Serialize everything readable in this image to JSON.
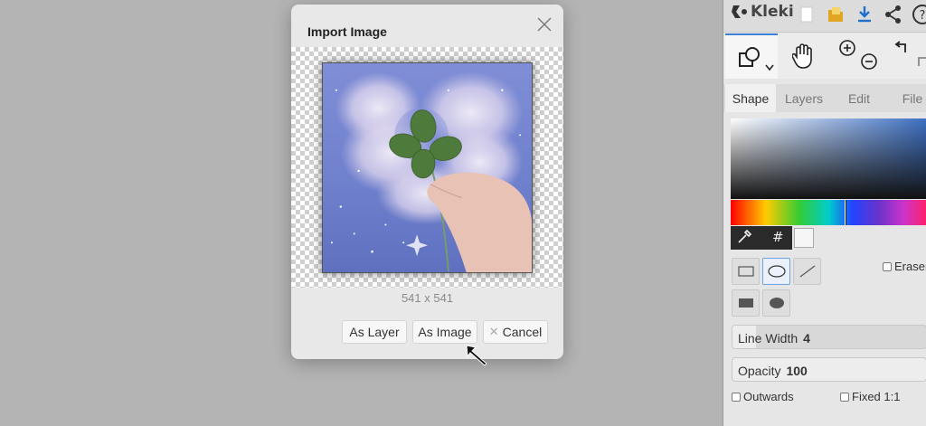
{
  "dialog": {
    "title": "Import Image",
    "dimensions": "541 x 541",
    "buttons": {
      "as_layer": "As Layer",
      "as_image": "As Image",
      "cancel": "Cancel"
    }
  },
  "app": {
    "name": "Kleki"
  },
  "tabs": [
    "Shape",
    "Layers",
    "Edit",
    "File"
  ],
  "shape_options": {
    "eraser_label": "Eraser",
    "outwards_label": "Outwards",
    "fixed_label": "Fixed 1:1"
  },
  "sliders": {
    "line_width": {
      "label": "Line Width",
      "value": "4",
      "fill": 0.12
    },
    "opacity": {
      "label": "Opacity",
      "value": "100",
      "fill": 1.0
    }
  },
  "color": {
    "hash": "#",
    "accent": "#3b82d6"
  }
}
